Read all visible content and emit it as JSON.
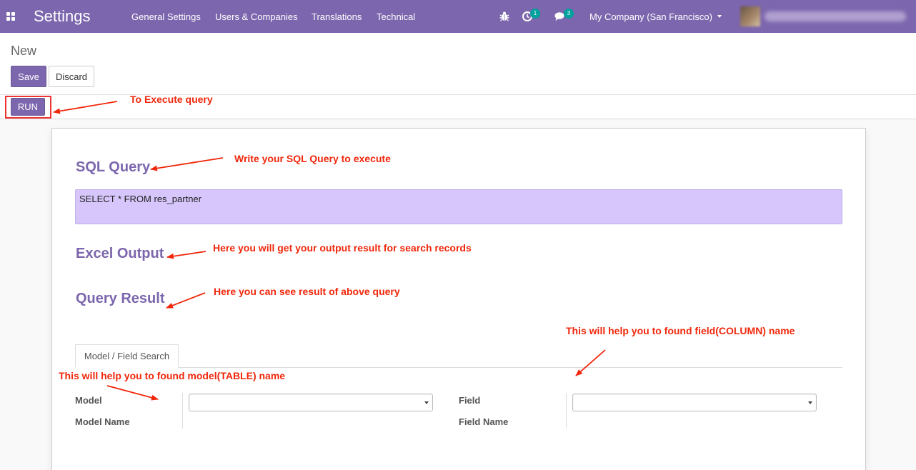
{
  "navbar": {
    "app_title": "Settings",
    "menu": [
      "General Settings",
      "Users & Companies",
      "Translations",
      "Technical"
    ],
    "activity_count": "1",
    "messages_count": "3",
    "company": "My Company (San Francisco)",
    "accent_color": "#7c66ad",
    "badge_color": "#00a09d"
  },
  "control_panel": {
    "breadcrumb": "New",
    "save_label": "Save",
    "discard_label": "Discard"
  },
  "statusbar": {
    "run_label": "RUN"
  },
  "form": {
    "sql_query_title": "SQL Query",
    "sql_query_value": "SELECT * FROM res_partner",
    "excel_output_title": "Excel Output",
    "query_result_title": "Query Result",
    "tab_label": "Model / Field Search",
    "model_label": "Model",
    "model_name_label": "Model Name",
    "field_label": "Field",
    "field_name_label": "Field Name",
    "sql_box_color": "#d6c6fb"
  },
  "annotations": {
    "run": "To Execute query",
    "sql": "Write your SQL Query to execute",
    "excel": "Here you will get your output result for search records",
    "result": "Here you can see result of above query",
    "field": "This will help you to found field(COLUMN) name",
    "model": "This will help you to found model(TABLE) name",
    "color": "#f0270b"
  }
}
